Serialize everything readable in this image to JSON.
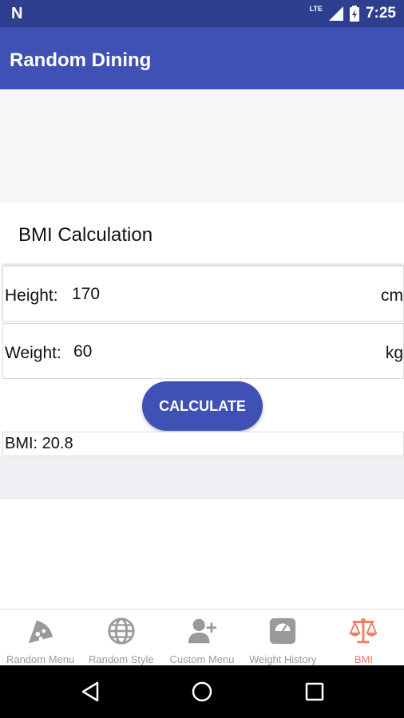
{
  "status_bar": {
    "time": "7:25",
    "network": "LTE",
    "logo": "N"
  },
  "app_bar": {
    "title": "Random Dining"
  },
  "bmi": {
    "section_title": "BMI Calculation",
    "height": {
      "label": "Height:",
      "value": "170",
      "unit": "cm"
    },
    "weight": {
      "label": "Weight:",
      "value": "60",
      "unit": "kg"
    },
    "calculate_label": "CALCULATE",
    "result": "BMI: 20.8"
  },
  "bottom_nav": {
    "items": [
      {
        "label": "Random Menu",
        "icon": "pizza-icon"
      },
      {
        "label": "Random Style",
        "icon": "globe-icon"
      },
      {
        "label": "Custom Menu",
        "icon": "person-add-icon"
      },
      {
        "label": "Weight History",
        "icon": "scale-icon"
      },
      {
        "label": "BMI",
        "icon": "balance-icon"
      }
    ],
    "active_index": 4
  },
  "colors": {
    "primary": "#3f51b5",
    "primary_dark": "#2f3f8f",
    "nav_active": "#f07c66",
    "nav_inactive": "#9a9a9a"
  }
}
